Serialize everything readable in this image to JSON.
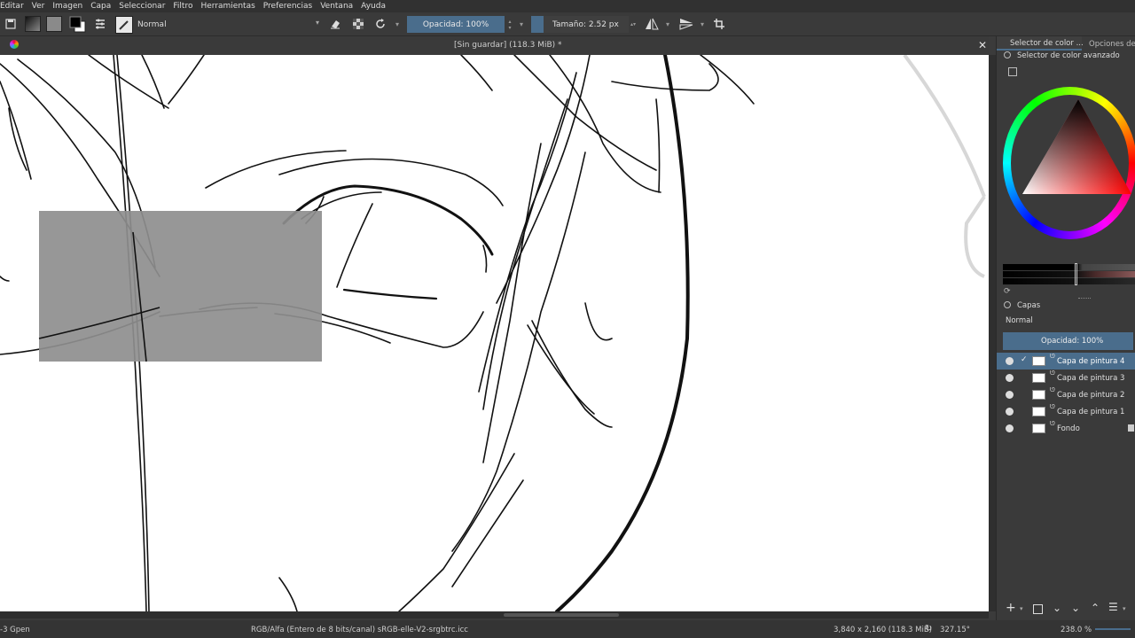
{
  "menu": [
    "Editar",
    "Ver",
    "Imagen",
    "Capa",
    "Seleccionar",
    "Filtro",
    "Herramientas",
    "Preferencias",
    "Ventana",
    "Ayuda"
  ],
  "toolbar": {
    "blend_mode": "Normal",
    "opacity": "Opacidad: 100%",
    "size": "Tamaño: 2.52 px"
  },
  "document": {
    "title": "[Sin guardar]  (118.3 MiB) *"
  },
  "dock": {
    "tab_color": "Selector de color ...",
    "tab_options": "Opciones de la",
    "color_panel_title": "Selector de color avanzado",
    "layers_title": "Capas",
    "layer_blend": "Normal",
    "layer_opacity": "Opacidad:  100%",
    "layers": [
      {
        "name": "Capa de pintura 4",
        "active": true
      },
      {
        "name": "Capa de pintura 3",
        "active": false
      },
      {
        "name": "Capa de pintura 2",
        "active": false
      },
      {
        "name": "Capa de pintura 1",
        "active": false
      },
      {
        "name": "Fondo",
        "active": false
      }
    ]
  },
  "status": {
    "brush": "-3 Gpen",
    "color_info": "RGB/Alfa (Entero de 8 bits/canal)  sRGB-elle-V2-srgbtrc.icc",
    "dimensions": "3,840 x 2,160 (118.3 MiB)",
    "rotation": "327.15°",
    "zoom": "238.0 %"
  },
  "colors": {
    "accent": "#4a6d8c",
    "panel": "#3a3a3a",
    "canvas": "#ffffff"
  }
}
